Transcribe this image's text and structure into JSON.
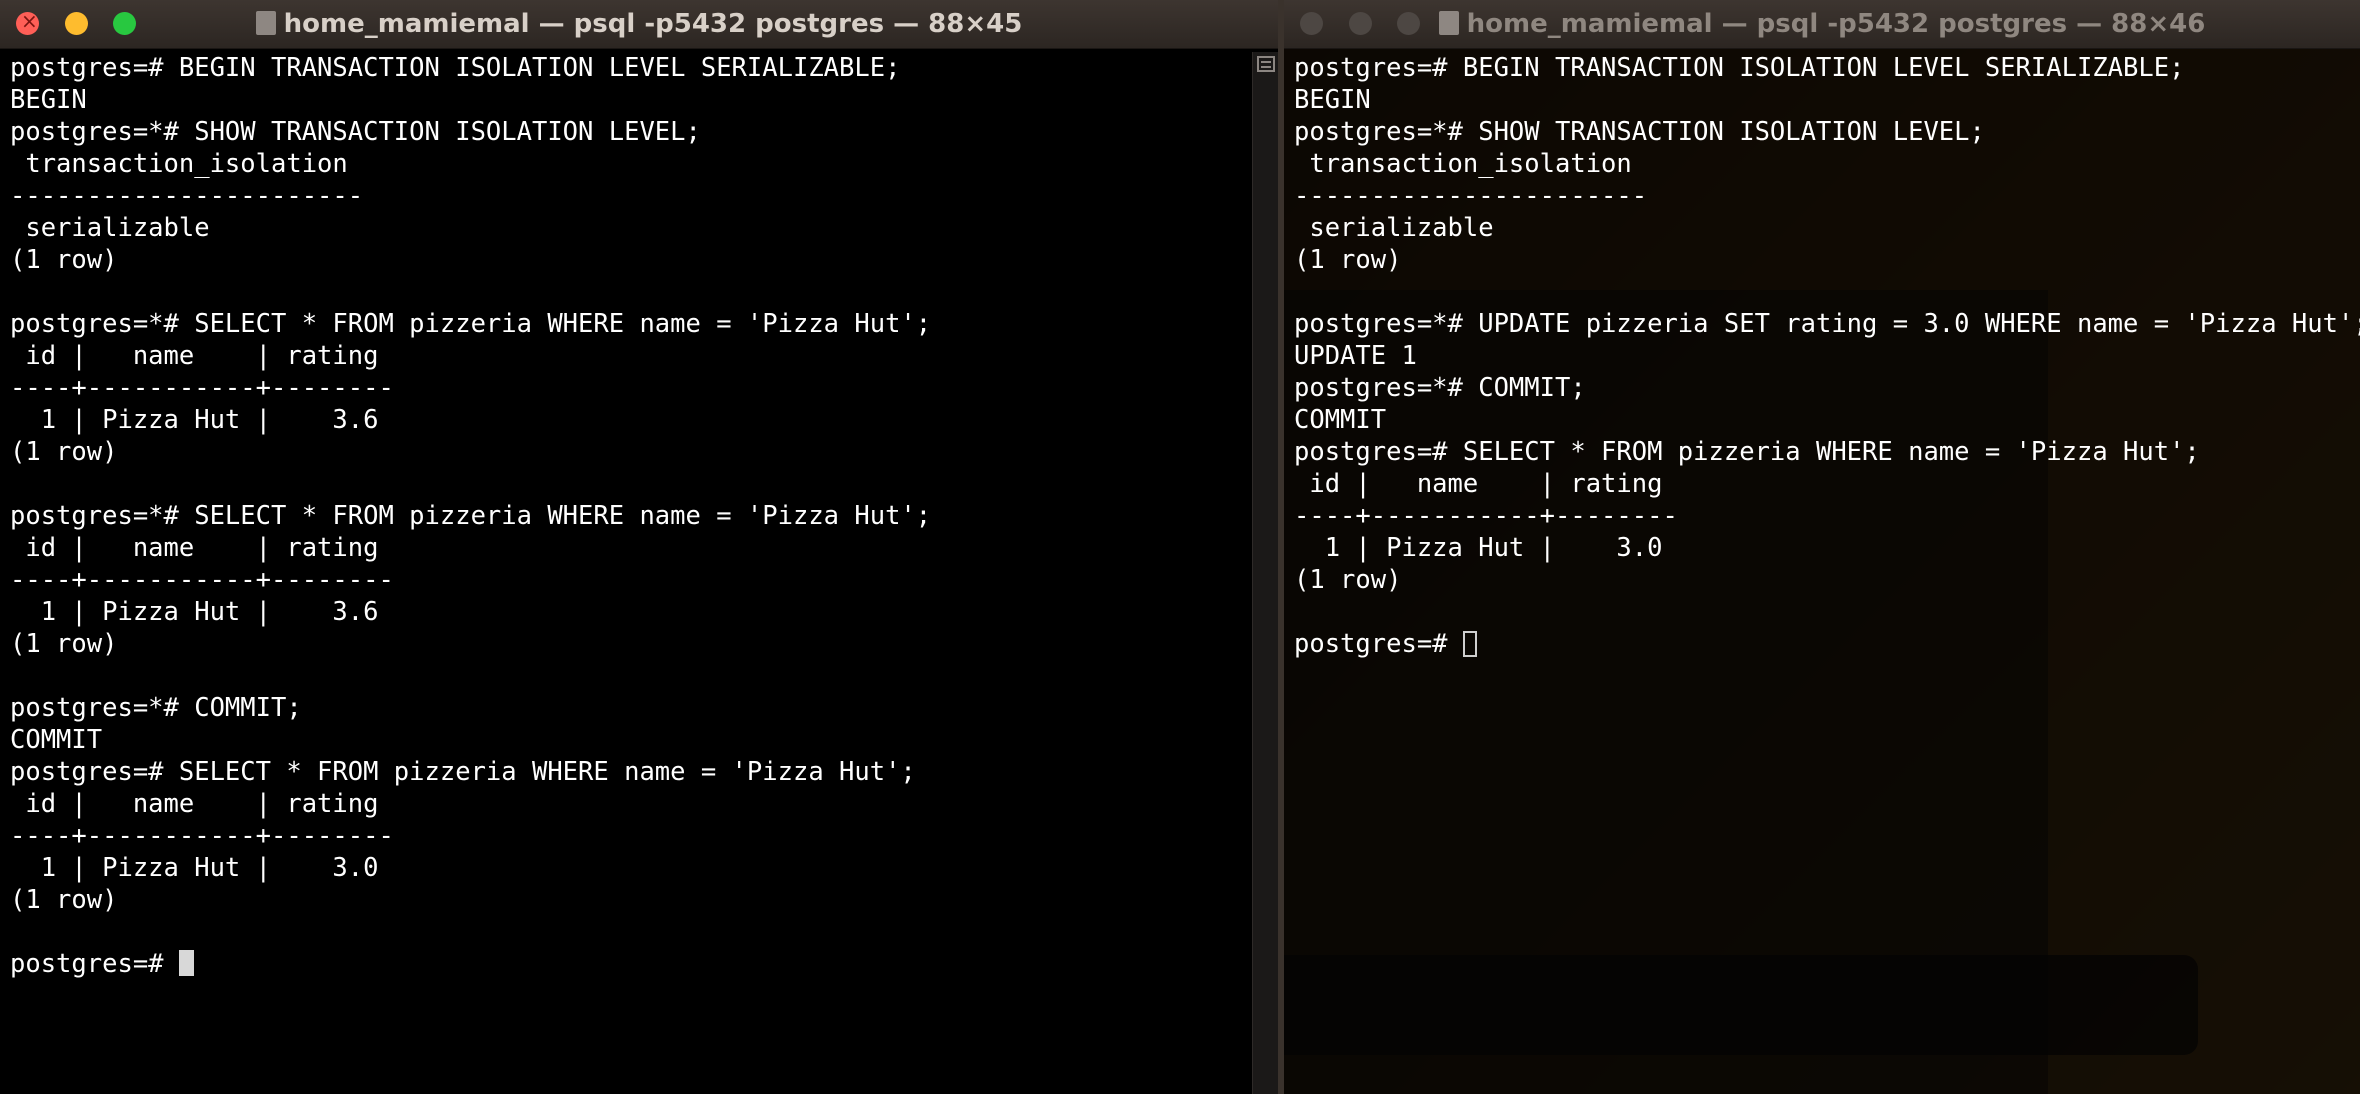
{
  "left_window": {
    "title": "home_mamiemal — psql -p5432 postgres — 88×45",
    "lines": [
      "postgres=# BEGIN TRANSACTION ISOLATION LEVEL SERIALIZABLE;",
      "BEGIN",
      "postgres=*# SHOW TRANSACTION ISOLATION LEVEL;",
      " transaction_isolation",
      "-----------------------",
      " serializable",
      "(1 row)",
      "",
      "postgres=*# SELECT * FROM pizzeria WHERE name = 'Pizza Hut';",
      " id |   name    | rating",
      "----+-----------+--------",
      "  1 | Pizza Hut |    3.6",
      "(1 row)",
      "",
      "postgres=*# SELECT * FROM pizzeria WHERE name = 'Pizza Hut';",
      " id |   name    | rating",
      "----+-----------+--------",
      "  1 | Pizza Hut |    3.6",
      "(1 row)",
      "",
      "postgres=*# COMMIT;",
      "COMMIT",
      "postgres=# SELECT * FROM pizzeria WHERE name = 'Pizza Hut';",
      " id |   name    | rating",
      "----+-----------+--------",
      "  1 | Pizza Hut |    3.0",
      "(1 row)",
      ""
    ],
    "prompt": "postgres=# "
  },
  "right_window": {
    "title": "home_mamiemal — psql -p5432 postgres — 88×46",
    "lines": [
      "postgres=# BEGIN TRANSACTION ISOLATION LEVEL SERIALIZABLE;",
      "BEGIN",
      "postgres=*# SHOW TRANSACTION ISOLATION LEVEL;",
      " transaction_isolation",
      "-----------------------",
      " serializable",
      "(1 row)",
      "",
      "postgres=*# UPDATE pizzeria SET rating = 3.0 WHERE name = 'Pizza Hut';",
      "UPDATE 1",
      "postgres=*# COMMIT;",
      "COMMIT",
      "postgres=# SELECT * FROM pizzeria WHERE name = 'Pizza Hut';",
      " id |   name    | rating",
      "----+-----------+--------",
      "  1 | Pizza Hut |    3.0",
      "(1 row)",
      ""
    ],
    "prompt": "postgres=# "
  },
  "icons": {
    "traffic_lights": [
      "close-icon",
      "minimize-icon",
      "zoom-icon"
    ],
    "title_icon": "document-icon",
    "scroll_marks": "scroll-marks-icon"
  },
  "colors": {
    "terminal_bg": "#000000",
    "terminal_fg": "#ffffff",
    "close": "#ff5f57",
    "minimize": "#febc2e",
    "zoom": "#28c840"
  }
}
